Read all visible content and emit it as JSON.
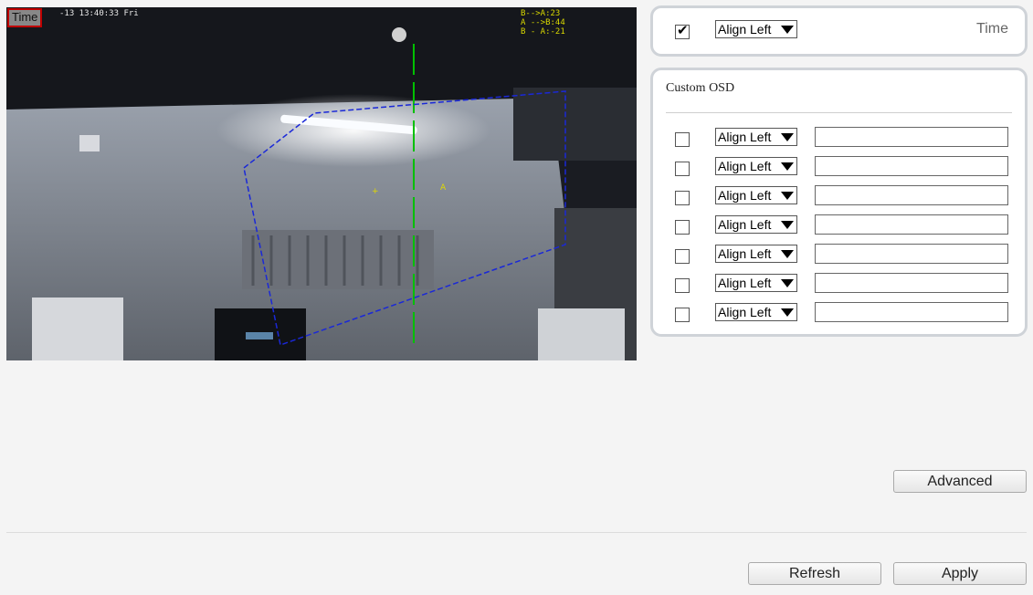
{
  "video": {
    "osd_time_tag": "Time",
    "timestamp": "-13 13:40:33 Fri",
    "counter_lines": [
      "B-->A:23",
      "A -->B:44",
      "B - A:-21"
    ],
    "line_colors": {
      "trip_line": "#00c000",
      "area": "#1a28d8"
    }
  },
  "time_osd": {
    "checked": true,
    "align": "Align Left",
    "label": "Time"
  },
  "custom_osd": {
    "title": "Custom OSD",
    "rows": [
      {
        "checked": false,
        "align": "Align Left",
        "text": ""
      },
      {
        "checked": false,
        "align": "Align Left",
        "text": ""
      },
      {
        "checked": false,
        "align": "Align Left",
        "text": ""
      },
      {
        "checked": false,
        "align": "Align Left",
        "text": ""
      },
      {
        "checked": false,
        "align": "Align Left",
        "text": ""
      },
      {
        "checked": false,
        "align": "Align Left",
        "text": ""
      },
      {
        "checked": false,
        "align": "Align Left",
        "text": ""
      }
    ]
  },
  "buttons": {
    "advanced": "Advanced",
    "refresh": "Refresh",
    "apply": "Apply"
  }
}
